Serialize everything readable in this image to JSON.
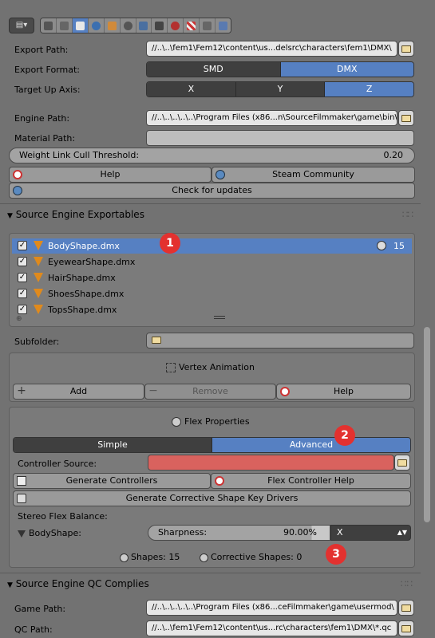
{
  "toolbar": {
    "editor_icon": "editor-type-icon",
    "tabs": [
      "render-icon",
      "scene-icon",
      "world-icon",
      "object-icon",
      "constraints-icon",
      "modifiers-icon",
      "data-icon",
      "material-icon",
      "texture-icon",
      "particles-icon",
      "physics-icon"
    ]
  },
  "export": {
    "path_label": "Export Path:",
    "path_value": "//..\\..\\fem1\\Fem12\\content\\us...delsrc\\characters\\fem1\\DMX\\",
    "format_label": "Export Format:",
    "format_options": [
      "SMD",
      "DMX"
    ],
    "format_selected": "DMX",
    "axis_label": "Target Up Axis:",
    "axis_options": [
      "X",
      "Y",
      "Z"
    ],
    "axis_selected": "Z",
    "engine_label": "Engine Path:",
    "engine_value": "//..\\..\\..\\..\\..\\Program Files (x86...n\\SourceFilmmaker\\game\\bin\\",
    "material_label": "Material Path:",
    "material_value": "",
    "cull_label": "Weight Link Cull Threshold:",
    "cull_value": "0.20",
    "help": "Help",
    "steam": "Steam Community",
    "updates": "Check for updates"
  },
  "exportables": {
    "title": "Source Engine Exportables",
    "items": [
      {
        "name": "BodyShape.dmx",
        "checked": "✓",
        "selected": true
      },
      {
        "name": "EyewearShape.dmx",
        "checked": "✓"
      },
      {
        "name": "HairShape.dmx",
        "checked": "✓"
      },
      {
        "name": "ShoesShape.dmx",
        "checked": "✓"
      },
      {
        "name": "TopsShape.dmx",
        "checked": "✓"
      }
    ],
    "selected_count": "15",
    "subfolder_label": "Subfolder:"
  },
  "vertex_anim": {
    "title": "Vertex Animation",
    "add": "Add",
    "remove": "Remove",
    "help": "Help"
  },
  "flex": {
    "title": "Flex Properties",
    "modes": [
      "Simple",
      "Advanced"
    ],
    "mode_selected": "Advanced",
    "controller_label": "Controller Source:",
    "generate": "Generate Controllers",
    "help": "Flex Controller Help",
    "corrective": "Generate Corrective Shape Key Drivers",
    "stereo_label": "Stereo Flex Balance:",
    "bodyshape_label": "BodyShape:",
    "sharpness_label": "Sharpness:",
    "sharpness_value": "90.00%",
    "axis_value": "X",
    "shapes": "Shapes: 15",
    "corrective_shapes": "Corrective Shapes: 0"
  },
  "qc": {
    "title": "Source Engine QC Complies",
    "game_label": "Game Path:",
    "game_value": "//..\\..\\..\\..\\..\\Program Files (x86...ceFilmmaker\\game\\usermod\\",
    "qc_label": "QC Path:",
    "qc_value": "//..\\..\\fem1\\Fem12\\content\\us...rc\\characters\\fem1\\DMX\\*.qc"
  },
  "markers": [
    "1",
    "2",
    "3"
  ],
  "colors": {
    "selected": "#5680c2",
    "controller_source_invalid": "#d9625e",
    "marker": "#e3312f"
  }
}
